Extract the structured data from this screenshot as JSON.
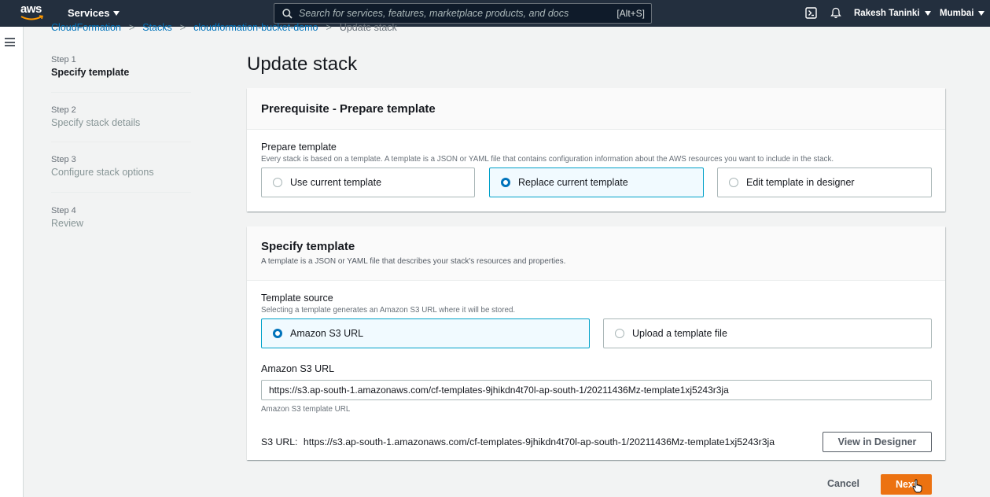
{
  "topnav": {
    "logo_text": "aws",
    "services_label": "Services",
    "search_placeholder": "Search for services, features, marketplace products, and docs",
    "search_shortcut": "[Alt+S]",
    "user_name": "Rakesh Taninki",
    "region": "Mumbai"
  },
  "breadcrumb": [
    "CloudFormation",
    "Stacks",
    "cloudformation-bucket-demo",
    "Update stack"
  ],
  "steps": [
    {
      "num": "Step 1",
      "label": "Specify template",
      "active": true
    },
    {
      "num": "Step 2",
      "label": "Specify stack details",
      "active": false
    },
    {
      "num": "Step 3",
      "label": "Configure stack options",
      "active": false
    },
    {
      "num": "Step 4",
      "label": "Review",
      "active": false
    }
  ],
  "page_title": "Update stack",
  "prereq": {
    "heading": "Prerequisite - Prepare template",
    "field_label": "Prepare template",
    "field_desc": "Every stack is based on a template. A template is a JSON or YAML file that contains configuration information about the AWS resources you want to include in the stack.",
    "options": [
      "Use current template",
      "Replace current template",
      "Edit template in designer"
    ],
    "selected": "Replace current template"
  },
  "specify": {
    "heading": "Specify template",
    "desc": "A template is a JSON or YAML file that describes your stack's resources and properties.",
    "source_label": "Template source",
    "source_desc": "Selecting a template generates an Amazon S3 URL where it will be stored.",
    "source_options": [
      "Amazon S3 URL",
      "Upload a template file"
    ],
    "source_selected": "Amazon S3 URL",
    "url_label": "Amazon S3 URL",
    "url_value": "https://s3.ap-south-1.amazonaws.com/cf-templates-9jhikdn4t70l-ap-south-1/20211436Mz-template1xj5243r3ja",
    "url_hint": "Amazon S3 template URL",
    "s3_prefix": "S3 URL:",
    "s3_value": "https://s3.ap-south-1.amazonaws.com/cf-templates-9jhikdn4t70l-ap-south-1/20211436Mz-template1xj5243r3ja",
    "view_designer_label": "View in Designer"
  },
  "footer": {
    "cancel_label": "Cancel",
    "next_label": "Next"
  },
  "colors": {
    "nav_bg": "#232f3e",
    "primary": "#ec7211",
    "selected_border": "#00a1c9",
    "link": "#0073bb"
  }
}
